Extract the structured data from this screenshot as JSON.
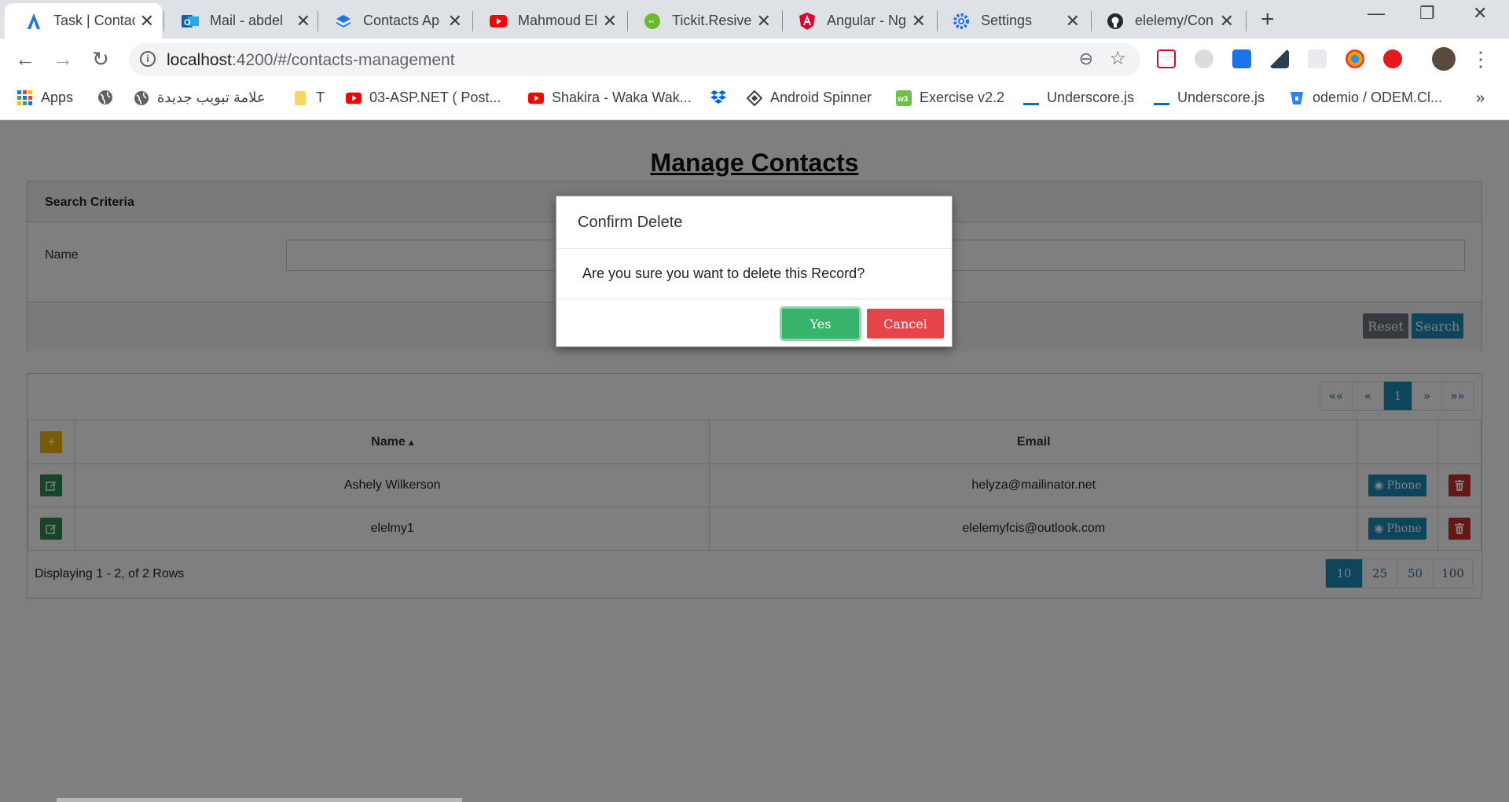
{
  "browser": {
    "tabs": [
      {
        "title": "Task | Contac",
        "active": true
      },
      {
        "title": "Mail - abdel"
      },
      {
        "title": "Contacts Ap"
      },
      {
        "title": "Mahmoud El"
      },
      {
        "title": "Tickit.Resive"
      },
      {
        "title": "Angular - Ng"
      },
      {
        "title": "Settings"
      },
      {
        "title": "elelemy/Con"
      }
    ],
    "url_host": "localhost",
    "url_path": ":4200/#/contacts-management",
    "bookmarks": [
      "Apps",
      "",
      "علامة تبويب جديدة",
      "T",
      "03-ASP.NET ( Post...",
      "Shakira - Waka Wak...",
      "",
      "Android Spinner",
      "Exercise v2.2",
      "Underscore.js",
      "Underscore.js",
      "odemio / ODEM.Cl...",
      "»"
    ]
  },
  "page": {
    "title": "Manage Contacts",
    "search": {
      "heading": "Search Criteria",
      "name_label": "Name",
      "name_value": "",
      "reset_label": "Reset",
      "search_label": "Search"
    },
    "grid": {
      "pager_top": [
        "««",
        "«",
        "1",
        "»",
        "»»"
      ],
      "add_icon": "+",
      "columns": {
        "name": "Name",
        "sort_indicator": "▴",
        "email": "Email"
      },
      "rows": [
        {
          "name": "Ashely Wilkerson",
          "email": "helyza@mailinator.net",
          "phone_label": "Phone"
        },
        {
          "name": "elelmy1",
          "email": "elelemyfcis@outlook.com",
          "phone_label": "Phone"
        }
      ],
      "footer_text": "Displaying 1 - 2, of 2 Rows",
      "page_sizes": [
        "10",
        "25",
        "50",
        "100"
      ],
      "selected_page_size": "10"
    }
  },
  "modal": {
    "title": "Confirm Delete",
    "message": "Are you sure you want to delete this Record?",
    "yes_label": "Yes",
    "cancel_label": "Cancel"
  },
  "colors": {
    "primary": "#1a8bb9",
    "success": "#37b36b",
    "danger": "#e8444c",
    "edit_green": "#2e8b57",
    "delete_red": "#c9302c",
    "add_yellow": "#f0b400",
    "reset_gray": "#6c757d"
  }
}
